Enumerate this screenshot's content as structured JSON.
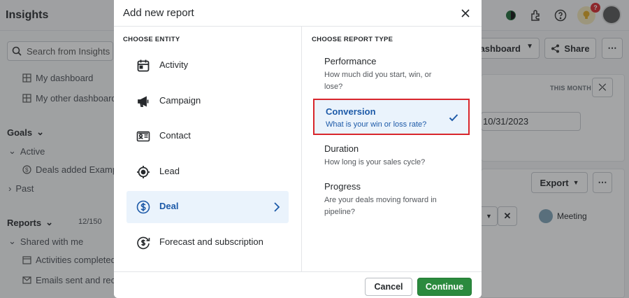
{
  "app": {
    "title": "Insights",
    "search_placeholder": "Search from Insights",
    "badge_count": "?",
    "sidebar": {
      "items": [
        {
          "label": "My dashboard"
        },
        {
          "label": "My other dashboard"
        }
      ],
      "goals_label": "Goals",
      "goals_active": "Active",
      "goals_item": "Deals added Example",
      "goals_past": "Past",
      "reports_label": "Reports",
      "reports_count": "12/150",
      "shared_label": "Shared with me",
      "shared_items": [
        "Activities completed",
        "Emails sent and received"
      ]
    },
    "right": {
      "dashboard_btn": "Dashboard",
      "share_btn": "Share",
      "this_month": "THIS MONTH",
      "date_value": "10/31/2023",
      "export_btn": "Export",
      "meeting_label": "Meeting"
    }
  },
  "modal": {
    "title": "Add new report",
    "entity_section": "CHOOSE ENTITY",
    "type_section": "CHOOSE REPORT TYPE",
    "entities": [
      {
        "label": "Activity",
        "icon": "calendar-icon"
      },
      {
        "label": "Campaign",
        "icon": "megaphone-icon"
      },
      {
        "label": "Contact",
        "icon": "contact-card-icon"
      },
      {
        "label": "Lead",
        "icon": "target-icon"
      },
      {
        "label": "Deal",
        "icon": "dollar-circle-icon",
        "selected": true
      },
      {
        "label": "Forecast and subscription",
        "icon": "forecast-dollar-icon"
      }
    ],
    "report_types": [
      {
        "title": "Performance",
        "desc": "How much did you start, win, or lose?"
      },
      {
        "title": "Conversion",
        "desc": "What is your win or loss rate?",
        "selected": true
      },
      {
        "title": "Duration",
        "desc": "How long is your sales cycle?"
      },
      {
        "title": "Progress",
        "desc": "Are your deals moving forward in pipeline?"
      }
    ],
    "cancel_label": "Cancel",
    "continue_label": "Continue"
  },
  "colors": {
    "accent_blue": "#1d5aa8",
    "selected_bg": "#eaf3fc",
    "highlight_red": "#d8262c",
    "continue_green": "#2b8a3e"
  }
}
